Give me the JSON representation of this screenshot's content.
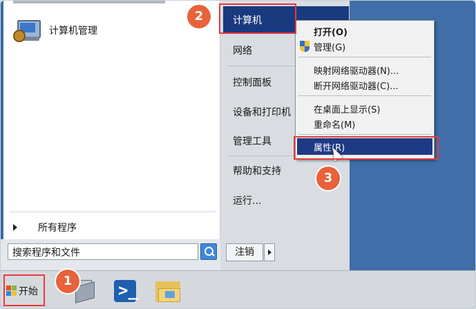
{
  "start_menu": {
    "pinned": [
      {
        "label": "计算机管理"
      }
    ],
    "all_programs": "所有程序",
    "search_placeholder": "搜索程序和文件",
    "right_pane": {
      "selected": "计算机",
      "items": [
        "网络",
        "控制面板",
        "设备和打印机",
        "管理工具",
        "帮助和支持",
        "运行..."
      ]
    },
    "logoff": "注销"
  },
  "context_menu": {
    "items": [
      {
        "label": "打开(O)",
        "bold": true
      },
      {
        "label": "管理(G)",
        "icon": "uac-shield-icon"
      },
      {
        "label": "映射网络驱动器(N)..."
      },
      {
        "label": "断开网络驱动器(C)..."
      },
      {
        "label": "在桌面上显示(S)"
      },
      {
        "label": "重命名(M)"
      },
      {
        "label": "属性(R)",
        "selected": true
      }
    ]
  },
  "taskbar": {
    "start_label": "开始",
    "apps": [
      "server-manager-icon",
      "powershell-icon",
      "explorer-folder-icon"
    ]
  },
  "annotations": {
    "badges": [
      "1",
      "2",
      "3"
    ],
    "color": "#e8623a"
  },
  "colors": {
    "selection": "#1a3a80",
    "desktop": "#3f6ea8",
    "highlight_box": "#e8393a"
  }
}
